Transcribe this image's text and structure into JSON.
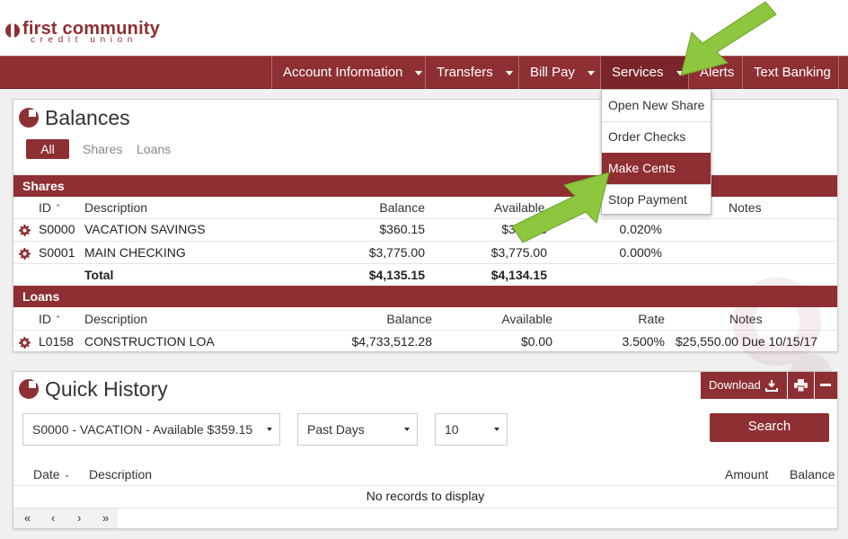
{
  "brand": {
    "name": "first community",
    "sub": "credit union",
    "color": "#8e2f33"
  },
  "nav": {
    "items": [
      "Account Information",
      "Transfers",
      "Bill Pay",
      "Services",
      "Alerts",
      "Text Banking"
    ],
    "active": "Services"
  },
  "services_menu": {
    "items": [
      "Open New Share",
      "Order Checks",
      "Make Cents",
      "Stop Payment"
    ],
    "highlighted": "Make Cents"
  },
  "balances": {
    "title": "Balances",
    "filters": [
      "All",
      "Shares",
      "Loans"
    ],
    "active_filter": "All",
    "shares": {
      "label": "Shares",
      "headers": {
        "id": "ID",
        "description": "Description",
        "balance": "Balance",
        "available": "Available",
        "notes": "Notes"
      },
      "rows": [
        {
          "id": "S0000",
          "description": "VACATION SAVINGS",
          "balance": "$360.15",
          "available": "$359.15",
          "rate": "0.020%"
        },
        {
          "id": "S0001",
          "description": "MAIN CHECKING",
          "balance": "$3,775.00",
          "available": "$3,775.00",
          "rate": "0.000%"
        }
      ],
      "total": {
        "label": "Total",
        "balance": "$4,135.15",
        "available": "$4,134.15"
      }
    },
    "loans": {
      "label": "Loans",
      "headers": {
        "id": "ID",
        "description": "Description",
        "balance": "Balance",
        "available": "Available",
        "rate": "Rate",
        "notes": "Notes"
      },
      "rows": [
        {
          "id": "L0158",
          "description": "CONSTRUCTION LOA",
          "balance": "$4,733,512.28",
          "available": "$0.00",
          "rate": "3.500%",
          "notes": "$25,550.00 Due 10/15/17"
        }
      ]
    }
  },
  "history": {
    "title": "Quick History",
    "download_label": "Download",
    "account_select": "S0000 - VACATION - Available $359.15",
    "period_select": "Past Days",
    "count_select": "10",
    "search_label": "Search",
    "headers": {
      "date": "Date",
      "description": "Description",
      "amount": "Amount",
      "balance": "Balance"
    },
    "empty_message": "No records to display",
    "pager": [
      "«",
      "‹",
      "›",
      "»"
    ]
  },
  "icons": {
    "gear": "gear-icon",
    "download": "download-icon",
    "print": "printer-icon",
    "minimize": "minus-icon",
    "panel": "pie-chart-icon"
  },
  "annotation_color": "#8dc63f"
}
